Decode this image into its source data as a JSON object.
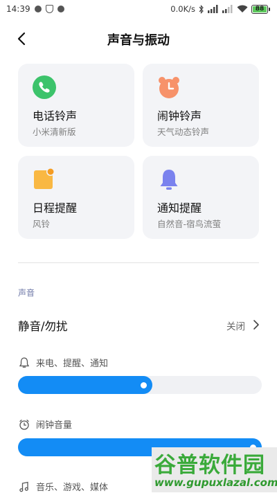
{
  "status_bar": {
    "time": "14:39",
    "net_speed": "0.0K/s",
    "battery": "88"
  },
  "header": {
    "title": "声音与振动"
  },
  "cards": [
    {
      "title": "电话铃声",
      "subtitle": "小米清新版",
      "icon": "phone-icon",
      "color": "#3cc36b"
    },
    {
      "title": "闹钟铃声",
      "subtitle": "天气动态铃声",
      "icon": "alarm-clock-icon",
      "color": "#f7926a"
    },
    {
      "title": "日程提醒",
      "subtitle": "风铃",
      "icon": "calendar-icon",
      "color": "#f9b843"
    },
    {
      "title": "通知提醒",
      "subtitle": "自然音-宿鸟流萤",
      "icon": "bell-icon",
      "color": "#7a82ee"
    }
  ],
  "section": {
    "label": "声音"
  },
  "dnd": {
    "label": "静音/勿扰",
    "value": "关闭"
  },
  "volumes": [
    {
      "label": "来电、提醒、通知",
      "icon": "bell-outline-icon",
      "level": 0.55
    },
    {
      "label": "闹钟音量",
      "icon": "alarm-outline-icon",
      "level": 1.0
    },
    {
      "label": "音乐、游戏、媒体",
      "icon": "music-note-icon"
    }
  ],
  "watermark": {
    "brand": "谷普软件园",
    "url": "www.gupuxlazal.com"
  },
  "colors": {
    "accent": "#138cf5",
    "card_bg": "#f3f4f7",
    "section_label": "#6f79a8"
  }
}
